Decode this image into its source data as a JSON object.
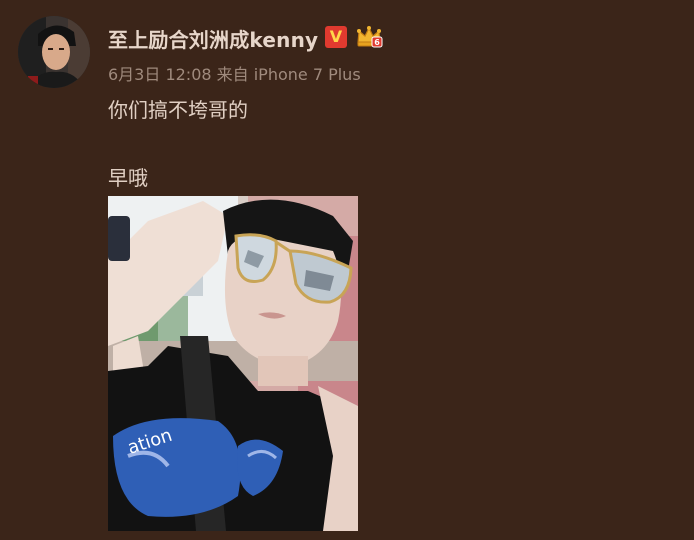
{
  "post": {
    "username": "至上励合刘洲成kenny",
    "badges": {
      "verified_label": "V",
      "crown_icon": "crown-icon",
      "crown_level": "6"
    },
    "meta": "6月3日 12:08 来自 iPhone 7 Plus",
    "text_lines": [
      "你们搞不垮哥的",
      "早哦"
    ],
    "photo_shirt_text": "ation"
  },
  "colors": {
    "background": "#3b2519",
    "username": "#e7d6ca",
    "meta": "#9f8a7d",
    "body_text": "#e0cfc3",
    "verified_bg": "#e03a2f",
    "verified_fg": "#ffd64a",
    "crown": "#f2b530"
  }
}
